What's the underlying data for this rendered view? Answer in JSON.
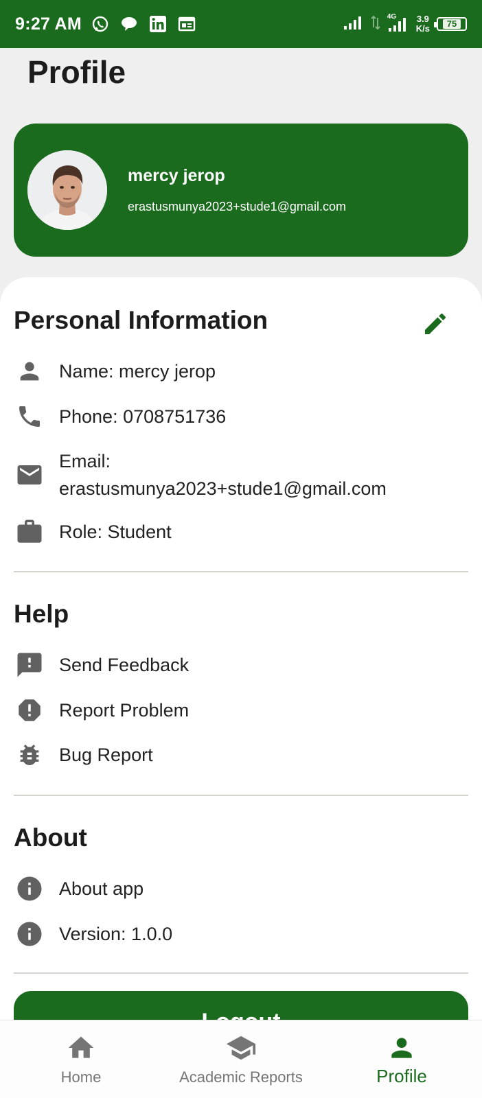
{
  "status_bar": {
    "time": "9:27 AM",
    "network_type": "4G",
    "speed_value": "3.9",
    "speed_unit": "K/s",
    "battery": "75",
    "app_icons": [
      "whatsapp-icon",
      "chat-bubble-icon",
      "linkedin-icon",
      "calendar-icon"
    ]
  },
  "page": {
    "title": "Profile"
  },
  "profile_card": {
    "name": "mercy jerop",
    "email": "erastusmunya2023+stude1@gmail.com"
  },
  "personal_info": {
    "title": "Personal Information",
    "items": [
      {
        "icon": "person-icon",
        "text": "Name: mercy jerop"
      },
      {
        "icon": "phone-icon",
        "text": "Phone: 0708751736"
      },
      {
        "icon": "email-icon",
        "label": "Email:",
        "value": "erastusmunya2023+stude1@gmail.com"
      },
      {
        "icon": "briefcase-icon",
        "text": "Role: Student"
      }
    ]
  },
  "help": {
    "title": "Help",
    "items": [
      {
        "icon": "feedback-icon",
        "text": "Send Feedback"
      },
      {
        "icon": "report-problem-icon",
        "text": "Report Problem"
      },
      {
        "icon": "bug-icon",
        "text": "Bug Report"
      }
    ]
  },
  "about": {
    "title": "About",
    "items": [
      {
        "icon": "info-icon",
        "text": "About app"
      },
      {
        "icon": "info-icon",
        "text": "Version: 1.0.0"
      }
    ]
  },
  "logout_label": "Logout",
  "bottom_nav": {
    "items": [
      {
        "icon": "home-icon",
        "label": "Home"
      },
      {
        "icon": "graduation-cap-icon",
        "label": "Academic Reports"
      },
      {
        "icon": "person-icon",
        "label": "Profile"
      }
    ],
    "active": "Profile"
  },
  "colors": {
    "primary_green": "#1b6b1e",
    "background": "#efefef",
    "icon_grey": "#616161",
    "nav_inactive": "#757575"
  }
}
